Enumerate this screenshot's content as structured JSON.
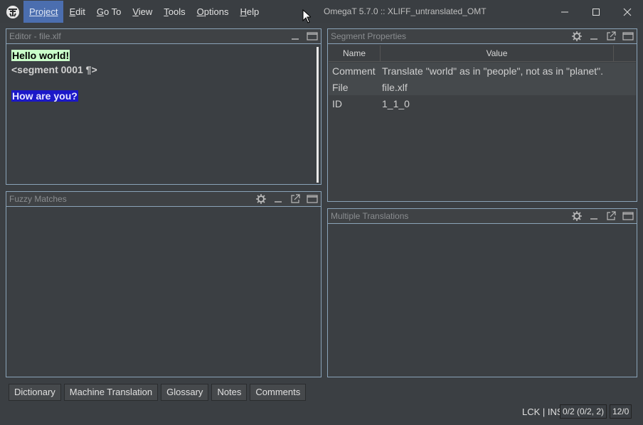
{
  "window": {
    "title": "OmegaT 5.7.0 :: XLIFF_untranslated_OMT"
  },
  "menu": [
    {
      "u": "P",
      "rest": "roject"
    },
    {
      "u": "E",
      "rest": "dit"
    },
    {
      "u": "G",
      "rest": "o To"
    },
    {
      "u": "V",
      "rest": "iew"
    },
    {
      "u": "T",
      "rest": "ools"
    },
    {
      "u": "O",
      "rest": "ptions"
    },
    {
      "u": "H",
      "rest": "elp"
    }
  ],
  "editor": {
    "title": "Editor - file.xlf",
    "source_text": "Hello world!",
    "segment_marker": "<segment 0001 ¶>",
    "target_text": "How are you?"
  },
  "fuzzy": {
    "title": "Fuzzy Matches"
  },
  "segment_properties": {
    "title": "Segment Properties",
    "columns": [
      "Name",
      "Value"
    ],
    "rows": [
      {
        "name": "Comment",
        "value": "Translate \"world\" as in \"people\", not as in \"planet\"."
      },
      {
        "name": "File",
        "value": "file.xlf"
      },
      {
        "name": "ID",
        "value": "1_1_0"
      }
    ]
  },
  "multiple": {
    "title": "Multiple Translations"
  },
  "tabs": [
    "Dictionary",
    "Machine Translation",
    "Glossary",
    "Notes",
    "Comments"
  ],
  "status": {
    "mode": "LCK | INS",
    "progress": "0/2 (0/2, 2)",
    "chars": "12/0"
  },
  "colors": {
    "menu_active": "#4b6eaf",
    "source_highlight": "#c9ffc9",
    "target_highlight": "#1b18c8",
    "pane_border": "#8aa3b8"
  }
}
